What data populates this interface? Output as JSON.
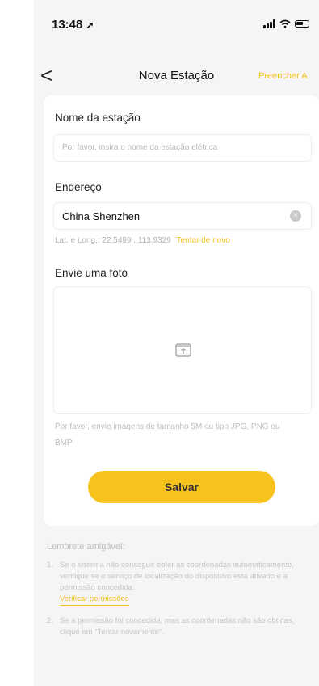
{
  "status_bar": {
    "time": "13:48",
    "location_glyph": "➚"
  },
  "nav": {
    "back": "<",
    "title": "Nova Estação",
    "fill_action": "Preencher A"
  },
  "form": {
    "name_label": "Nome da estação",
    "name_placeholder": "Por favor, insira o nome da estação elétrica",
    "address_label": "Endereço",
    "address_value": "China Shenzhen",
    "coords_text": "Lat. e Long.: 22.5499 , 113.9329",
    "retry_label": "Tentar de novo",
    "photo_label": "Envie uma foto",
    "photo_hint": "Por favor, envie imagens de tamanho 5M ou tipo JPG, PNG ou BMP",
    "save_label": "Salvar"
  },
  "reminder": {
    "title": "Lembrete amigável:",
    "item1_number": "1.",
    "item1_text": "Se o sistema não conseguir obter as coordenadas automaticamente, verifique se o serviço de localização do dispositivo está ativado e a permissão concedida.",
    "item1_link": "Verificar permissões",
    "item2_number": "2.",
    "item2_text": "Se a permissão foi concedida, mas as coordenadas não são obtidas, clique em \"Tentar novamente\"."
  }
}
